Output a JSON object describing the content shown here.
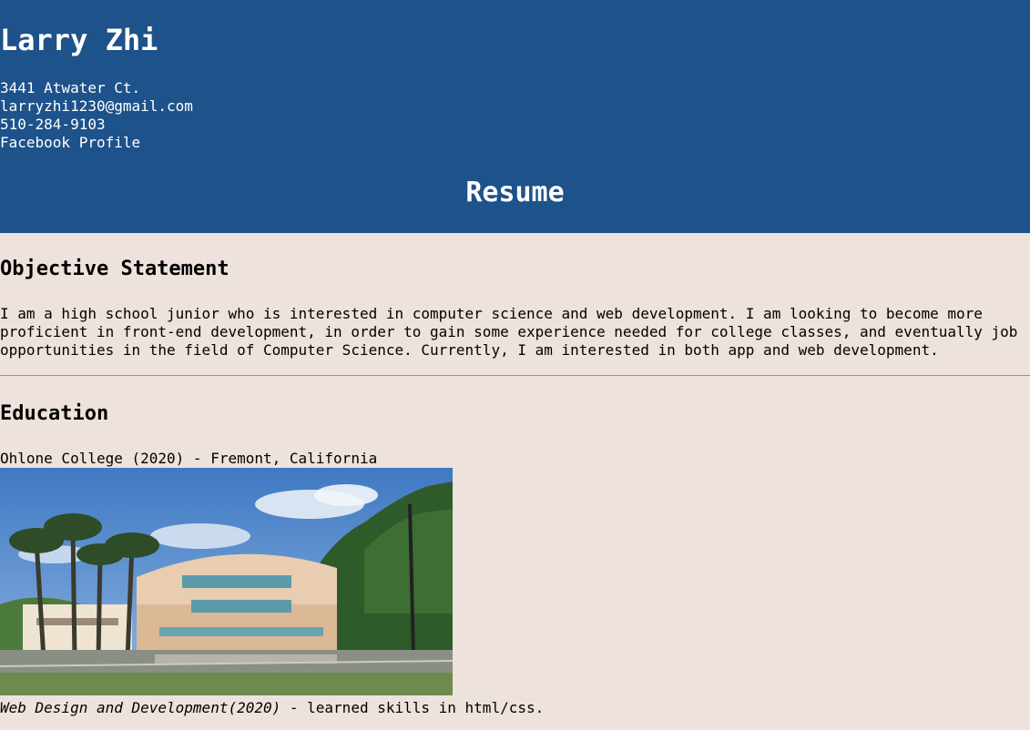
{
  "header": {
    "name": "Larry Zhi",
    "address": "3441 Atwater Ct.",
    "email": "larryzhi1230@gmail.com",
    "phone": "510-284-9103",
    "facebook_link": "Facebook Profile",
    "page_title": "Resume"
  },
  "objective": {
    "heading": "Objective Statement",
    "text": "I am a high school junior who is interested in computer science and web development. I am looking to become more proficient in front-end development, in order to gain some experience needed for college classes, and eventually job opportunities in the field of Computer Science. Currently, I am interested in both app and web development."
  },
  "education": {
    "heading": "Education",
    "school": "Ohlone College (2020) - Fremont, California",
    "course_title": "Web Design and Development(2020)",
    "course_desc": " - learned skills in html/css."
  },
  "colors": {
    "header_bg": "#1e528a",
    "page_bg": "#ede2dc"
  }
}
